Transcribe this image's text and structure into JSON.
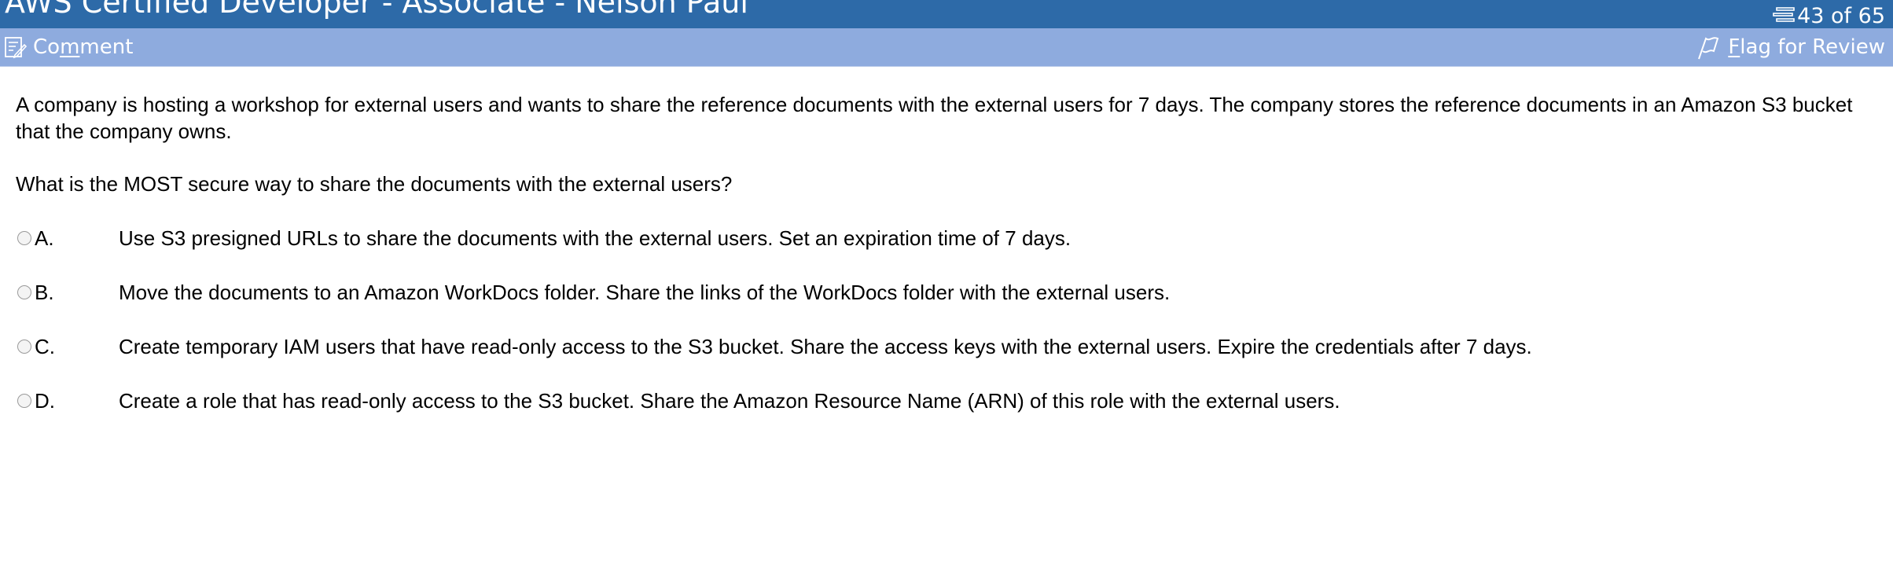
{
  "header": {
    "title": "AWS Certified Developer - Associate - Nelson Paul",
    "counter": "43 of 65",
    "counter_icon": "list-icon",
    "bg_color": "#2d6aa8"
  },
  "toolbar": {
    "comment_prefix": "Co",
    "comment_underlined": "m",
    "comment_suffix": "ment",
    "comment_icon": "comment-icon",
    "flag_underlined": "F",
    "flag_suffix": "lag for Review",
    "flag_icon": "flag-icon",
    "bg_color": "#8eabde"
  },
  "question": {
    "stem": "A company is hosting a workshop for external users and wants to share the reference documents with the external users for 7 days. The company stores the reference documents in an Amazon S3 bucket that the company owns.",
    "prompt": "What is the MOST secure way to share the documents with the external users?",
    "options": [
      {
        "letter": "A.",
        "text": "Use S3 presigned URLs to share the documents with the external users. Set an expiration time of 7 days."
      },
      {
        "letter": "B.",
        "text": "Move the documents to an Amazon WorkDocs folder. Share the links of the WorkDocs folder with the external users."
      },
      {
        "letter": "C.",
        "text": "Create temporary IAM users that have read-only access to the S3 bucket. Share the access keys with the external users. Expire the credentials after 7 days."
      },
      {
        "letter": "D.",
        "text": "Create a role that has read-only access to the S3 bucket. Share the Amazon Resource Name (ARN) of this role with the external users."
      }
    ]
  }
}
